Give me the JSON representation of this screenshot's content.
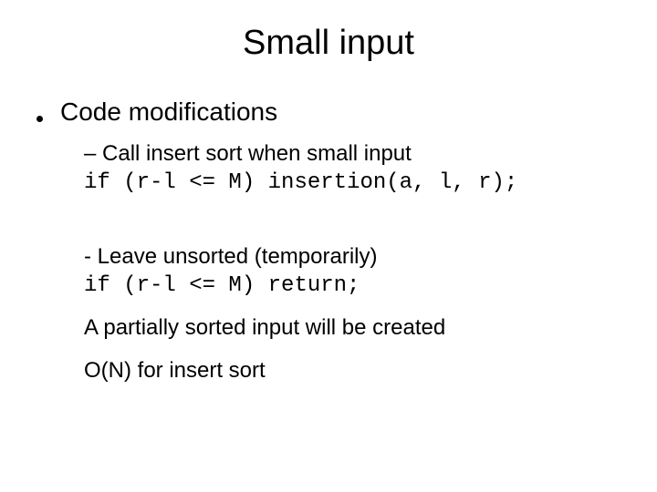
{
  "title": "Small input",
  "l1": {
    "text": "Code modifications"
  },
  "sub1": {
    "heading": "Call insert sort when small input",
    "code": "if (r-l <= M) insertion(a, l, r);"
  },
  "sub2": {
    "heading": " Leave unsorted (temporarily)",
    "code": "if (r-l <= M) return;"
  },
  "note1": "A partially sorted input will be created",
  "note2": "O(N) for insert sort"
}
